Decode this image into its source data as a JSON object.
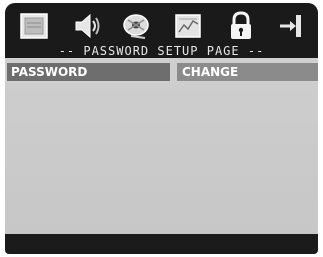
{
  "menu": {
    "icons": [
      "general-setup-icon",
      "audio-setup-icon",
      "video-setup-icon",
      "preference-setup-icon",
      "password-lock-icon",
      "exit-icon"
    ]
  },
  "page": {
    "title": "-- PASSWORD SETUP PAGE --"
  },
  "settings": {
    "rows": [
      {
        "label": "PASSWORD",
        "value": "CHANGE"
      }
    ]
  }
}
